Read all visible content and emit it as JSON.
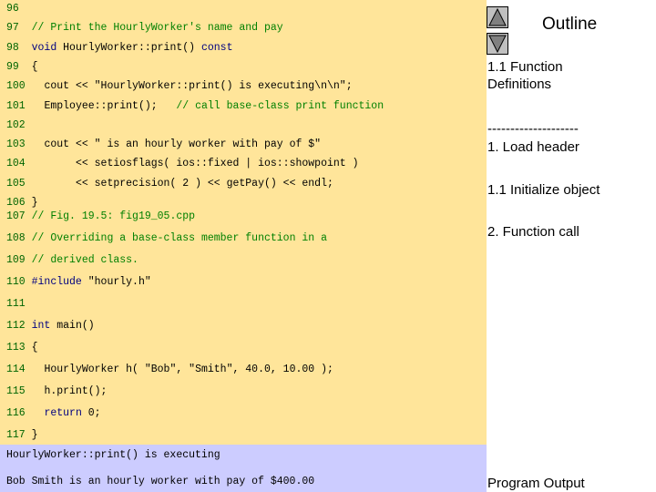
{
  "code_lines": [
    {
      "num": "96",
      "parts": []
    },
    {
      "num": "97",
      "parts": [
        {
          "t": "// Print the HourlyWorker's name and pay",
          "c": "cm"
        }
      ]
    },
    {
      "num": "98",
      "parts": [
        {
          "t": "void",
          "c": "kw"
        },
        {
          "t": " HourlyWorker::print() ",
          "c": ""
        },
        {
          "t": "const",
          "c": "kw"
        }
      ]
    },
    {
      "num": "99",
      "parts": [
        {
          "t": "{",
          "c": ""
        }
      ]
    },
    {
      "num": "100",
      "parts": [
        {
          "t": "cout << \"HourlyWorker::print() is executing\\n\\n\";",
          "c": ""
        }
      ]
    },
    {
      "num": "101",
      "parts": [
        {
          "t": "Employee::print();   ",
          "c": ""
        },
        {
          "t": "// call base-class print function",
          "c": "cm"
        }
      ]
    },
    {
      "num": "102",
      "parts": []
    },
    {
      "num": "103",
      "parts": [
        {
          "t": "cout << \" is an hourly worker with pay of $\"",
          "c": ""
        }
      ]
    },
    {
      "num": "104",
      "parts": [
        {
          "t": "     << setiosflags( ios::fixed | ios::showpoint )",
          "c": ""
        }
      ]
    },
    {
      "num": "105",
      "parts": [
        {
          "t": "     << setprecision( 2 ) << getPay() << endl;",
          "c": ""
        }
      ]
    },
    {
      "num": "106",
      "parts": [
        {
          "t": "}",
          "c": ""
        }
      ]
    },
    {
      "num": "107",
      "parts": [
        {
          "t": "// Fig. 19.5: fig19_05.cpp",
          "c": "cm"
        }
      ]
    },
    {
      "num": "108",
      "parts": [
        {
          "t": "// Overriding a base-class member function in a",
          "c": "cm"
        }
      ]
    },
    {
      "num": "109",
      "parts": [
        {
          "t": "// derived class.",
          "c": "cm"
        }
      ]
    },
    {
      "num": "110",
      "parts": [
        {
          "t": "#include",
          "c": "kw"
        },
        {
          "t": " \"hourly.h\"",
          "c": ""
        }
      ]
    },
    {
      "num": "111",
      "parts": []
    },
    {
      "num": "112",
      "parts": [
        {
          "t": "int",
          "c": "kw"
        },
        {
          "t": " main()",
          "c": ""
        }
      ]
    },
    {
      "num": "113",
      "parts": [
        {
          "t": "{",
          "c": ""
        }
      ]
    },
    {
      "num": "114",
      "parts": [
        {
          "t": "HourlyWorker h( \"Bob\", \"Smith\", 40.0, 10.00 );",
          "c": ""
        }
      ]
    },
    {
      "num": "115",
      "parts": [
        {
          "t": "h.print();",
          "c": ""
        }
      ]
    },
    {
      "num": "116",
      "parts": [
        {
          "t": "return",
          "c": "kw"
        },
        {
          "t": " 0;",
          "c": ""
        }
      ]
    },
    {
      "num": "117",
      "parts": [
        {
          "t": "}",
          "c": ""
        }
      ]
    }
  ],
  "output_lines": [
    "HourlyWorker::print() is executing",
    "Bob Smith is an hourly worker with pay of $400.00"
  ],
  "sidebar": {
    "title": "Outline",
    "items": [
      "1.1 Function Definitions",
      "--------------------",
      "1. Load header",
      "1.1 Initialize object",
      "2. Function call"
    ],
    "program_output_label": "Program Output"
  },
  "icons": {
    "prev": "triangle-up-icon",
    "next": "triangle-down-icon"
  }
}
